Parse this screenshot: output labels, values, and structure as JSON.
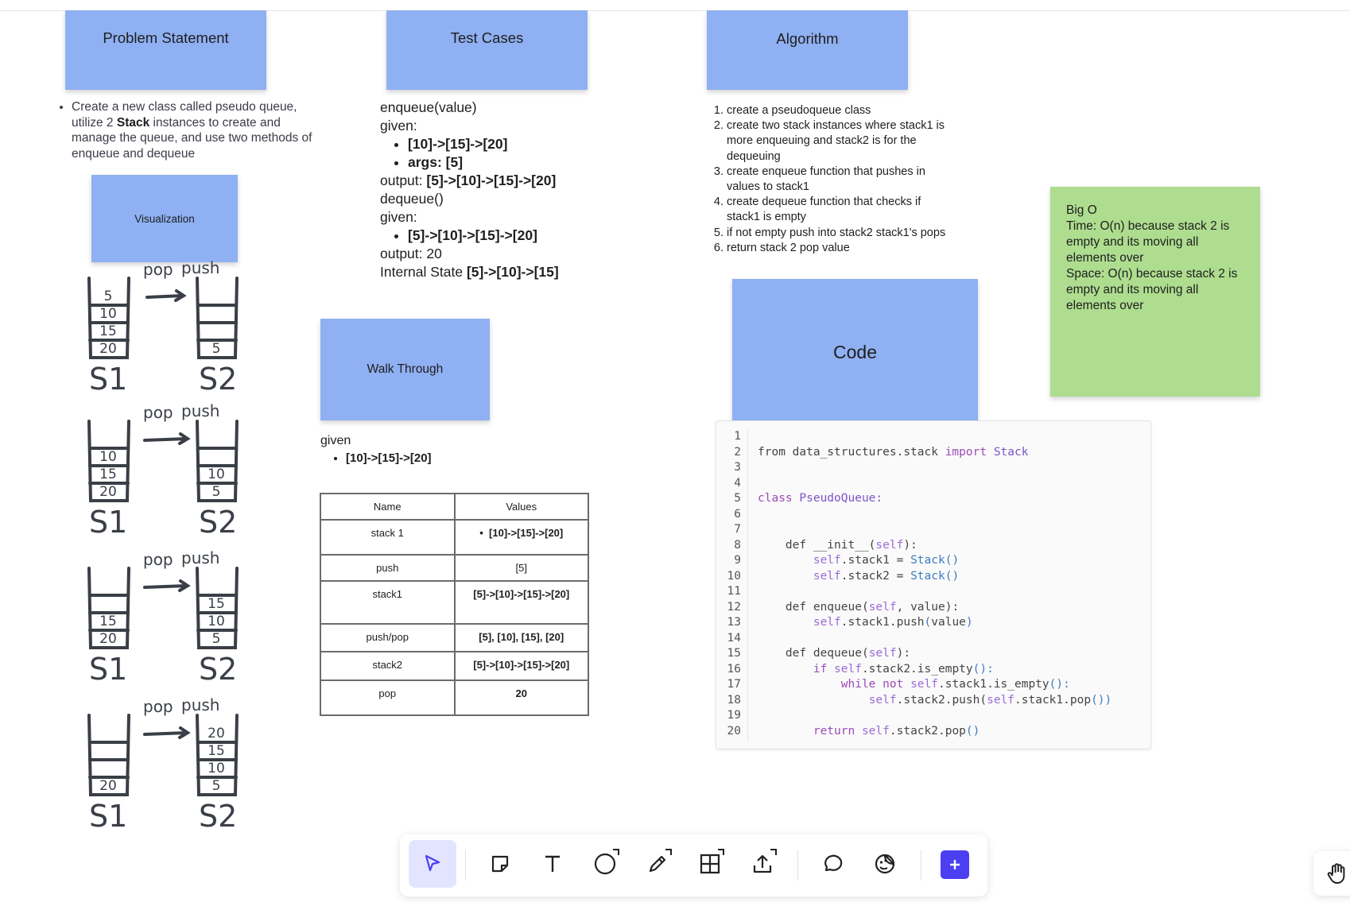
{
  "notes": {
    "problem_statement": "Problem Statement",
    "test_cases": "Test Cases",
    "algorithm": "Algorithm",
    "visualization": "Visualization",
    "walk_through": "Walk Through",
    "code": "Code"
  },
  "problem": {
    "pre": "Create a new class called pseudo queue, utilize 2 ",
    "bold": "Stack",
    "post": " instances to create and manage the queue, and use two methods of enqueue and dequeue"
  },
  "test_cases": {
    "enqueue": "enqueue(value)",
    "given": "given:",
    "enq_given_items": [
      "[10]->[15]->[20]",
      "args: [5]"
    ],
    "output_label": "output: ",
    "enq_output": "[5]->[10]->[15]->[20]",
    "dequeue": "dequeue()",
    "given2": "given:",
    "deq_given_items": [
      "[5]->[10]->[15]->[20]"
    ],
    "deq_output": "output: 20",
    "internal_label": "Internal State ",
    "internal_state": "[5]->[10]->[15]"
  },
  "algorithm_steps": [
    "create a pseudoqueue class",
    "create  two stack instances where stack1 is more enqueuing and stack2 is for the dequeuing",
    "create enqueue function that pushes in values to stack1",
    "create dequeue function that checks if stack1 is empty",
    "if not empty push into stack2 stack1's pops",
    "return stack 2 pop value"
  ],
  "big_o": {
    "title": "Big O",
    "time": "Time: O(n) because stack 2 is empty and its moving all elements over",
    "space": "Space: O(n) because stack 2 is empty and its moving all elements over"
  },
  "walk": {
    "given": "given",
    "given_item": "[10]->[15]->[20]"
  },
  "walk_table": {
    "headers": [
      "Name",
      "Values"
    ],
    "rows": [
      {
        "name": "stack 1",
        "value": "[10]->[15]->[20]"
      },
      {
        "name": "push",
        "value": "[5]"
      },
      {
        "name": "stack1",
        "value": "[5]->[10]->[15]->[20]"
      },
      {
        "name": "push/pop",
        "value": "[5], [10], [15], [20]"
      },
      {
        "name": "stack2",
        "value": "[5]->[10]->[15]->[20]"
      },
      {
        "name": "pop",
        "value": "20"
      }
    ]
  },
  "code": {
    "line_numbers": [
      "1",
      "2",
      "3",
      "4",
      "5",
      "6",
      "7",
      "8",
      "9",
      "10",
      "11",
      "12",
      "13",
      "14",
      "15",
      "16",
      "17",
      "18",
      "19",
      "20"
    ],
    "l1a": "from data_structures.stack ",
    "l1b": "import",
    "l1c": " Stack",
    "l4a": "class",
    "l4b": " PseudoQueue:",
    "l7a": "    def __init__(",
    "l7b": "self",
    "l7c": "):",
    "l8a": "        ",
    "l8b": "self",
    "l8c": ".stack1 = ",
    "l8d": "Stack()",
    "l9a": "        ",
    "l9b": "self",
    "l9c": ".stack2 = ",
    "l9d": "Stack()",
    "l11a": "    def enqueue(",
    "l11b": "self",
    "l11c": ", value):",
    "l12a": "        ",
    "l12b": "self",
    "l12c": ".stack1.push",
    "l12d": "(",
    "l12e": "value",
    "l12f": ")",
    "l14a": "    def dequeue(",
    "l14b": "self",
    "l14c": "):",
    "l15a": "        if ",
    "l15b": "self",
    "l15c": ".stack2.is_empty",
    "l15d": "():",
    "l16a": "            while not ",
    "l16b": "self",
    "l16c": ".stack1.is_empty",
    "l16d": "():",
    "l17a": "                ",
    "l17b": "self",
    "l17c": ".stack2.push(",
    "l17d": "self",
    "l17e": ".stack1.pop",
    "l17f": "())",
    "l19a": "        return ",
    "l19b": "self",
    "l19c": ".stack2.pop",
    "l19d": "()"
  },
  "sketch": {
    "labels": [
      "S1",
      "S2"
    ],
    "captions": [
      "pop",
      "push"
    ],
    "rows": [
      {
        "s1": [
          "5",
          "10",
          "15",
          "20"
        ],
        "s2": [
          "5"
        ]
      },
      {
        "s1": [
          "10",
          "15",
          "20"
        ],
        "s2": [
          "10",
          "5"
        ]
      },
      {
        "s1": [
          "15",
          "20"
        ],
        "s2": [
          "15",
          "10",
          "5"
        ]
      },
      {
        "s1": [
          "20"
        ],
        "s2": [
          "20",
          "15",
          "10",
          "5"
        ]
      }
    ]
  },
  "toolbar": {
    "tools": [
      "select-tool",
      "sticky-note-tool",
      "text-tool",
      "shape-tool",
      "pen-tool",
      "table-tool",
      "upload-tool",
      "comment-tool",
      "sticker-tool",
      "add-button"
    ]
  },
  "colors": {
    "sticky_blue": "#8fb0f2",
    "sticky_green": "#aedd8f",
    "accent": "#4b3ff1"
  }
}
